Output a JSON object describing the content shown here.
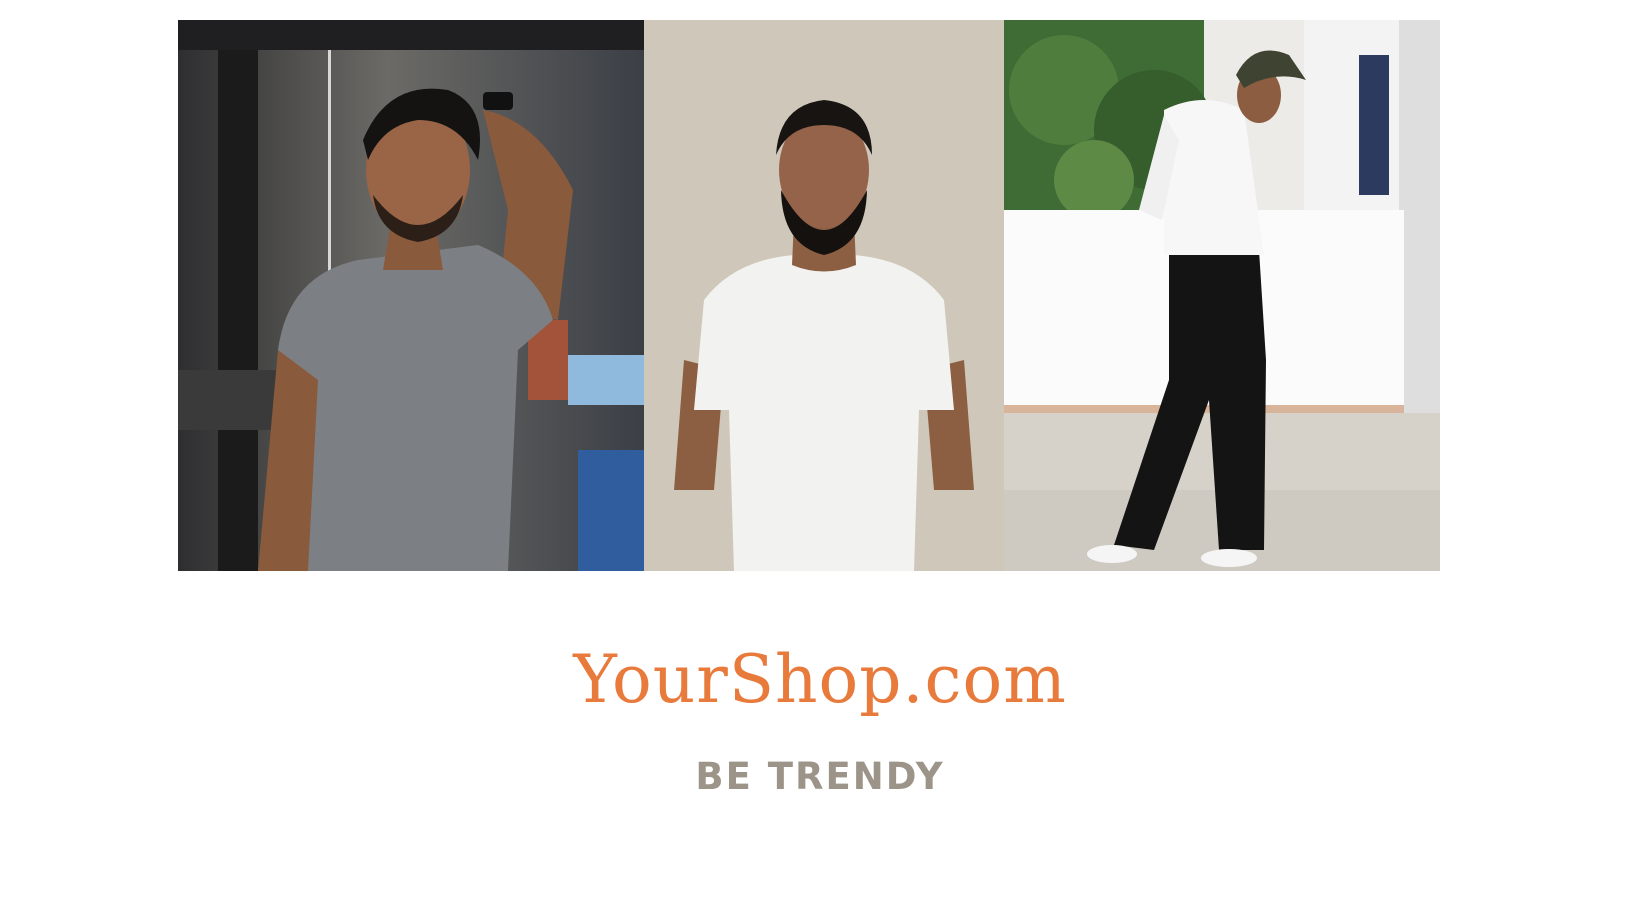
{
  "brand": {
    "name": "YourShop.com",
    "tagline": "BE TRENDY",
    "accent_color": "#E87A3C",
    "tagline_color": "#9C9488"
  },
  "photos": [
    {
      "subject": "man-grey-tshirt"
    },
    {
      "subject": "man-white-tshirt"
    },
    {
      "subject": "man-white-shirt-black-pants"
    }
  ]
}
